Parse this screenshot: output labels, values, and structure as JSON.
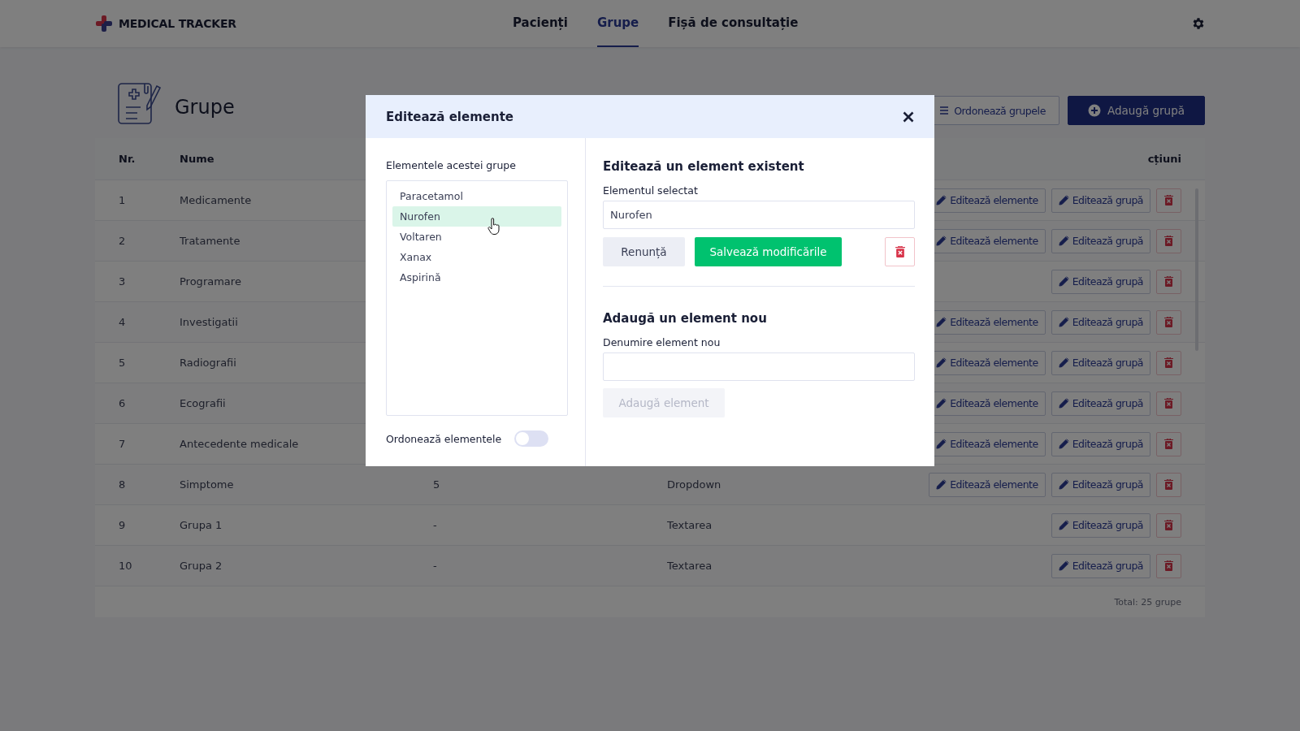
{
  "app": {
    "logo": "MEDICAL TRACKER"
  },
  "nav": [
    {
      "label": "Pacienți",
      "selected": false
    },
    {
      "label": "Grupe",
      "selected": true
    },
    {
      "label": "Fișă de consultație",
      "selected": false
    }
  ],
  "page": {
    "title": "Grupe",
    "buttons": [
      {
        "label": "Ordonează grupele",
        "kind": "outline"
      },
      {
        "label": "Adaugă grupă",
        "kind": "primary"
      }
    ]
  },
  "table": {
    "columns": {
      "nr": "Nr.",
      "name": "Nume",
      "actions": "cțiuni"
    },
    "rows": [
      {
        "nr": "1",
        "name": "Medicamente",
        "edit_elements": "Editează elemente",
        "edit_group": "Editează grupă"
      },
      {
        "nr": "2",
        "name": "Tratamente",
        "edit_elements": "Editează elemente",
        "edit_group": "Editează grupă"
      },
      {
        "nr": "3",
        "name": "Programare",
        "edit_group": "Editează grupă"
      },
      {
        "nr": "4",
        "name": "Investigatii",
        "edit_elements": "Editează elemente",
        "edit_group": "Editează grupă"
      },
      {
        "nr": "5",
        "name": "Radiografii",
        "edit_elements": "Editează elemente",
        "edit_group": "Editează grupă"
      },
      {
        "nr": "6",
        "name": "Ecografii",
        "edit_elements": "Editează elemente",
        "edit_group": "Editează grupă"
      },
      {
        "nr": "7",
        "name": "Antecedente medicale",
        "edit_elements": "Editează elemente",
        "edit_group": "Editează grupă"
      },
      {
        "nr": "8",
        "name": "Simptome",
        "count": "5",
        "type": "Dropdown",
        "edit_elements": "Editează elemente",
        "edit_group": "Editează grupă"
      },
      {
        "nr": "9",
        "name": "Grupa 1",
        "count": "-",
        "type": "Textarea",
        "edit_group": "Editează grupă"
      },
      {
        "nr": "10",
        "name": "Grupa 2",
        "count": "-",
        "type": "Textarea",
        "edit_group": "Editează grupă"
      }
    ],
    "footer": "Total: 25 grupe"
  },
  "modal": {
    "title": "Editează elemente",
    "list_label": "Elementele acestei grupe",
    "items": [
      {
        "label": "Paracetamol",
        "selected": false
      },
      {
        "label": "Nurofen",
        "selected": true
      },
      {
        "label": "Voltaren",
        "selected": false
      },
      {
        "label": "Xanax",
        "selected": false
      },
      {
        "label": "Aspirină",
        "selected": false
      }
    ],
    "sort_toggle": {
      "label": "Ordonează elementele",
      "on": false
    },
    "edit_section": {
      "heading": "Editează un element existent",
      "field_label": "Elementul selectat",
      "value": "Nurofen",
      "cancel": "Renunță",
      "save": "Salvează modificările"
    },
    "add_section": {
      "heading": "Adaugă un element nou",
      "field_label": "Denumire element nou",
      "button": {
        "label": "Adaugă element",
        "disabled": true
      }
    }
  }
}
